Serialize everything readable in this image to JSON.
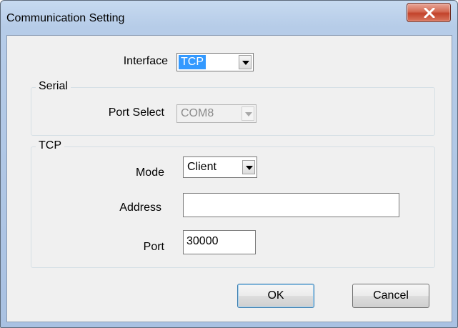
{
  "window": {
    "title": "Communication Setting"
  },
  "interface": {
    "label": "Interface",
    "value": "TCP"
  },
  "serial": {
    "group_title": "Serial",
    "port_label": "Port Select",
    "port_value": "COM8"
  },
  "tcp": {
    "group_title": "TCP",
    "mode_label": "Mode",
    "mode_value": "Client",
    "address_label": "Address",
    "address_value": "",
    "port_label": "Port",
    "port_value": "30000"
  },
  "buttons": {
    "ok": "OK",
    "cancel": "Cancel"
  },
  "icons": {
    "close": "close-icon",
    "dropdown": "chevron-down-icon"
  }
}
